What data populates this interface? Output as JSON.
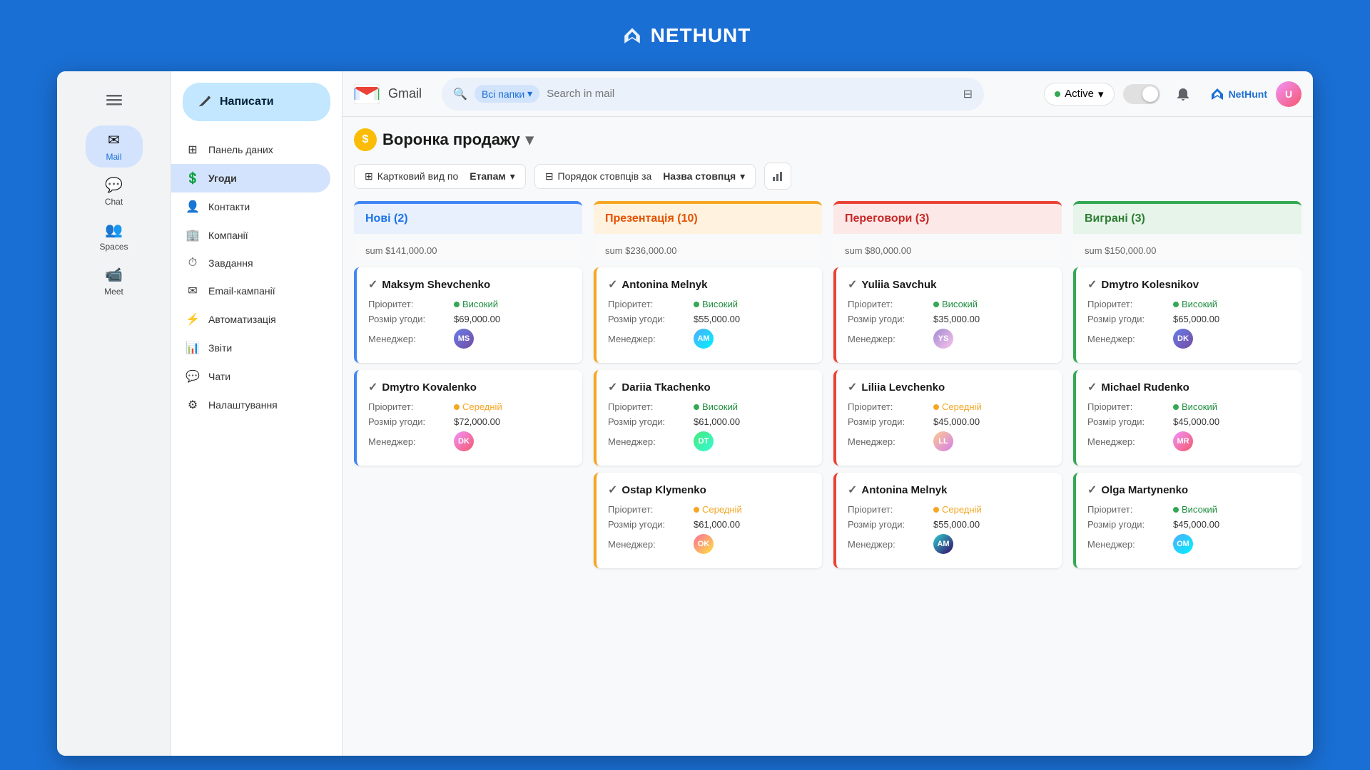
{
  "topbar": {
    "logo_text": "NETHUNT"
  },
  "header": {
    "gmail_label": "Gmail",
    "search_placeholder": "Search in mail",
    "folders_label": "Всі папки",
    "active_label": "Active",
    "filter_icon": "⚙",
    "settings_icon": "⚙"
  },
  "sidebar": {
    "items": [
      {
        "id": "mail",
        "label": "Mail",
        "icon": "✉",
        "active": true
      },
      {
        "id": "chat",
        "label": "Chat",
        "icon": "💬",
        "active": false
      },
      {
        "id": "spaces",
        "label": "Spaces",
        "icon": "👥",
        "active": false
      },
      {
        "id": "meet",
        "label": "Meet",
        "icon": "📹",
        "active": false
      }
    ]
  },
  "left_panel": {
    "compose_label": "Написати",
    "items": [
      {
        "id": "dashboard",
        "label": "Панель даних",
        "icon": "⊞",
        "active": false
      },
      {
        "id": "deals",
        "label": "Угоди",
        "icon": "💲",
        "active": true
      },
      {
        "id": "contacts",
        "label": "Контакти",
        "icon": "👤",
        "active": false
      },
      {
        "id": "companies",
        "label": "Компанії",
        "icon": "🏢",
        "active": false
      },
      {
        "id": "tasks",
        "label": "Завдання",
        "icon": "⏱",
        "active": false
      },
      {
        "id": "email_campaigns",
        "label": "Email-кампанії",
        "icon": "✉",
        "active": false
      },
      {
        "id": "automation",
        "label": "Автоматизація",
        "icon": "⚡",
        "active": false
      },
      {
        "id": "reports",
        "label": "Звіти",
        "icon": "📊",
        "active": false
      },
      {
        "id": "chats",
        "label": "Чати",
        "icon": "💬",
        "active": false
      },
      {
        "id": "settings",
        "label": "Налаштування",
        "icon": "⚙",
        "active": false
      }
    ]
  },
  "pipeline": {
    "title": "Воронка продажу",
    "view_label": "Картковий вид по",
    "view_value": "Етапам",
    "order_label": "Порядок стовпців за",
    "order_value": "Назва стовпця",
    "columns": [
      {
        "id": "new",
        "title": "Нові (2)",
        "color_class": "blue",
        "border_class": "blue-border",
        "sum_label": "sum $141,000.00",
        "deals": [
          {
            "name": "Maksym Shevchenko",
            "priority_label": "Пріоритет:",
            "priority_value": "Високий",
            "priority_class": "high",
            "amount_label": "Розмір угоди:",
            "amount_value": "$69,000.00",
            "manager_label": "Менеджер:",
            "avatar_class": "av1",
            "avatar_initials": "MS"
          },
          {
            "name": "Dmytro Kovalenko",
            "priority_label": "Пріоритет:",
            "priority_value": "Середній",
            "priority_class": "medium",
            "amount_label": "Розмір угоди:",
            "amount_value": "$72,000.00",
            "manager_label": "Менеджер:",
            "avatar_class": "av2",
            "avatar_initials": "DK"
          }
        ]
      },
      {
        "id": "presentation",
        "title": "Презентація (10)",
        "color_class": "orange",
        "border_class": "orange-border",
        "sum_label": "sum $236,000.00",
        "deals": [
          {
            "name": "Antonina Melnyk",
            "priority_label": "Пріоритет:",
            "priority_value": "Високий",
            "priority_class": "high",
            "amount_label": "Розмір угоди:",
            "amount_value": "$55,000.00",
            "manager_label": "Менеджер:",
            "avatar_class": "av3",
            "avatar_initials": "AM"
          },
          {
            "name": "Dariia Tkachenko",
            "priority_label": "Пріоритет:",
            "priority_value": "Високий",
            "priority_class": "high",
            "amount_label": "Розмір угоди:",
            "amount_value": "$61,000.00",
            "manager_label": "Менеджер:",
            "avatar_class": "av4",
            "avatar_initials": "DT"
          },
          {
            "name": "Ostap Klymenko",
            "priority_label": "Пріоритет:",
            "priority_value": "Середній",
            "priority_class": "medium",
            "amount_label": "Розмір угоди:",
            "amount_value": "$61,000.00",
            "manager_label": "Менеджер:",
            "avatar_class": "av5",
            "avatar_initials": "OK"
          }
        ]
      },
      {
        "id": "negotiations",
        "title": "Переговори (3)",
        "color_class": "red",
        "border_class": "red-border",
        "sum_label": "sum $80,000.00",
        "deals": [
          {
            "name": "Yuliia Savchuk",
            "priority_label": "Пріоритет:",
            "priority_value": "Високий",
            "priority_class": "high",
            "amount_label": "Розмір угоди:",
            "amount_value": "$35,000.00",
            "manager_label": "Менеджер:",
            "avatar_class": "av6",
            "avatar_initials": "YS"
          },
          {
            "name": "Liliia Levchenko",
            "priority_label": "Пріоритет:",
            "priority_value": "Середній",
            "priority_class": "medium",
            "amount_label": "Розмір угоди:",
            "amount_value": "$45,000.00",
            "manager_label": "Менеджер:",
            "avatar_class": "av7",
            "avatar_initials": "LL"
          },
          {
            "name": "Antonina Melnyk",
            "priority_label": "Пріоритет:",
            "priority_value": "Середній",
            "priority_class": "medium",
            "amount_label": "Розмір угоди:",
            "amount_value": "$55,000.00",
            "manager_label": "Менеджер:",
            "avatar_class": "av8",
            "avatar_initials": "AM"
          }
        ]
      },
      {
        "id": "won",
        "title": "Виграні (3)",
        "color_class": "green",
        "border_class": "green-border",
        "sum_label": "sum $150,000.00",
        "deals": [
          {
            "name": "Dmytro Kolesnikov",
            "priority_label": "Пріоритет:",
            "priority_value": "Високий",
            "priority_class": "high",
            "amount_label": "Розмір угоди:",
            "amount_value": "$65,000.00",
            "manager_label": "Менеджер:",
            "avatar_class": "av1",
            "avatar_initials": "DK"
          },
          {
            "name": "Michael Rudenko",
            "priority_label": "Пріоритет:",
            "priority_value": "Високий",
            "priority_class": "high",
            "amount_label": "Розмір угоди:",
            "amount_value": "$45,000.00",
            "manager_label": "Менеджер:",
            "avatar_class": "av2",
            "avatar_initials": "MR"
          },
          {
            "name": "Olga Martynenko",
            "priority_label": "Пріоритет:",
            "priority_value": "Високий",
            "priority_class": "high",
            "amount_label": "Розмір угоди:",
            "amount_value": "$45,000.00",
            "manager_label": "Менеджер:",
            "avatar_class": "av3",
            "avatar_initials": "OM"
          }
        ]
      }
    ]
  }
}
